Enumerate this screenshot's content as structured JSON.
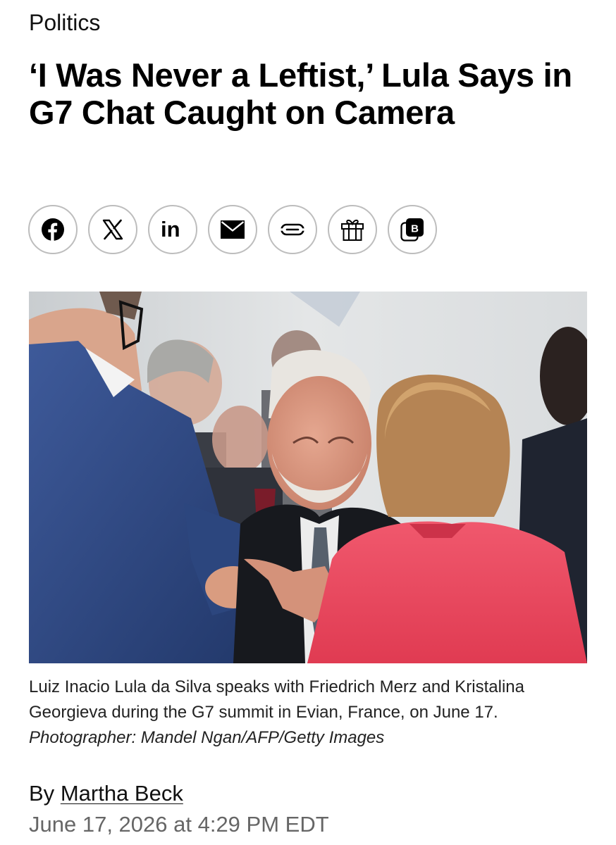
{
  "section": "Politics",
  "headline": "‘I Was Never a Leftist,’ Lula Says in G7 Chat Caught on Camera",
  "share_buttons": [
    {
      "icon": "facebook-icon",
      "label": "Facebook"
    },
    {
      "icon": "x-icon",
      "label": "X"
    },
    {
      "icon": "linkedin-icon",
      "label": "LinkedIn"
    },
    {
      "icon": "email-icon",
      "label": "Email"
    },
    {
      "icon": "link-icon",
      "label": "Copy link"
    },
    {
      "icon": "gift-icon",
      "label": "Gift article"
    },
    {
      "icon": "bookmark-b-icon",
      "label": "Save"
    }
  ],
  "caption": {
    "text": "Luiz Inacio Lula da Silva speaks with Friedrich Merz and Kristalina Georgieva during the G7 summit in Evian, France, on June 17.",
    "credit": "Photographer: Mandel Ngan/AFP/Getty Images"
  },
  "byline": {
    "prefix": "By",
    "author": "Martha Beck"
  },
  "date": "June 17, 2026 at 4:29 PM EDT",
  "colors": {
    "text": "#000000",
    "muted": "#666666",
    "button_border": "#bdbdbd"
  }
}
